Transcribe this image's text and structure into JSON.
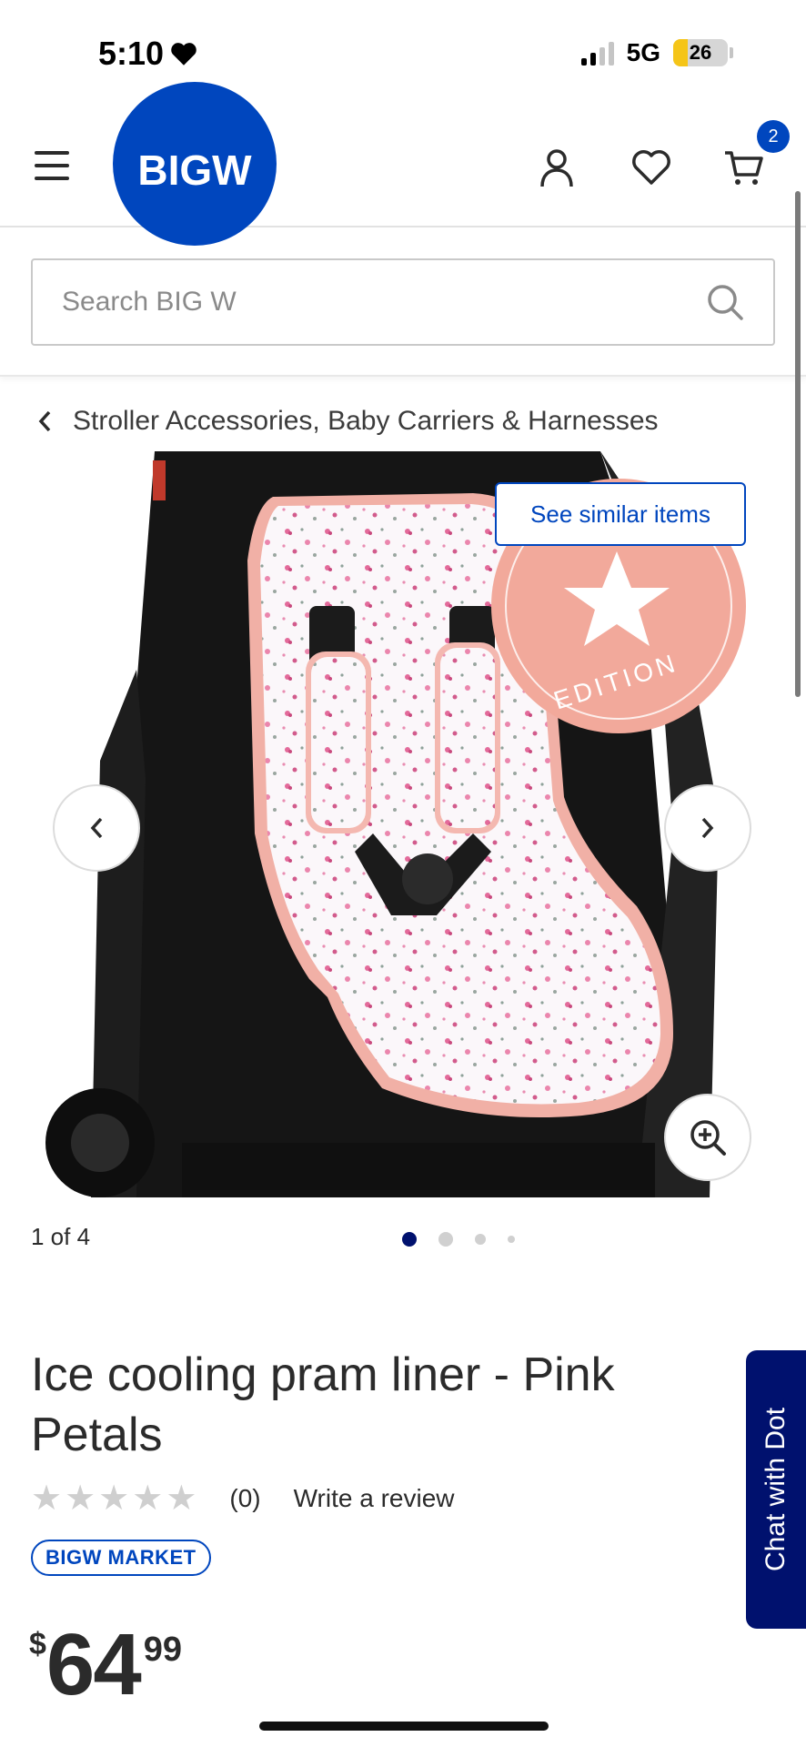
{
  "status_bar": {
    "time": "5:10",
    "network": "5G",
    "battery": "26",
    "battery_level": 0.26
  },
  "header": {
    "logo_text": "BIGW",
    "cart_count": "2",
    "icons": [
      "menu-icon",
      "account-icon",
      "heart-icon",
      "cart-icon"
    ]
  },
  "search": {
    "placeholder": "Search BIG W"
  },
  "breadcrumb": {
    "label": "Stroller Accessories, Baby Carriers & Harnesses"
  },
  "gallery": {
    "see_similar_label": "See similar items",
    "badge_text": "EDITION",
    "position_text": "1 of 4",
    "total_images": 4,
    "active_index": 0
  },
  "product": {
    "title": "Ice cooling pram liner - Pink Petals",
    "rating_value": 0,
    "review_count": "(0)",
    "write_review": "Write a review",
    "market_badge": "BIGW MARKET",
    "price_currency": "$",
    "price_dollars": "64",
    "price_cents": "99"
  },
  "chat": {
    "label": "Chat with Dot"
  },
  "colors": {
    "brand_blue": "#0046be",
    "chat_navy": "#00116e",
    "badge_pink": "#f2a99b"
  }
}
